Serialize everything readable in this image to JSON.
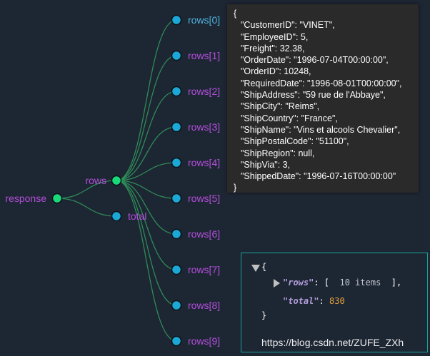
{
  "tree": {
    "root": {
      "label": "response"
    },
    "children": [
      {
        "label": "rows"
      },
      {
        "label": "total"
      }
    ],
    "leaves": [
      "rows[0]",
      "rows[1]",
      "rows[2]",
      "rows[3]",
      "rows[4]",
      "rows[5]",
      "rows[6]",
      "rows[7]",
      "rows[8]",
      "rows[9]"
    ],
    "colors": {
      "link": "#2e8b57",
      "expanded_node": "#19d97a",
      "leaf_node": "#1ba8d6",
      "label_purple": "#b44fdb",
      "label_blue": "#4fb3dc"
    }
  },
  "tooltip": {
    "open": "{",
    "lines": [
      "\"CustomerID\": \"VINET\",",
      "\"EmployeeID\": 5,",
      "\"Freight\": 32.38,",
      "\"OrderDate\": \"1996-07-04T00:00:00\",",
      "\"OrderID\": 10248,",
      "\"RequiredDate\": \"1996-08-01T00:00:00\",",
      "\"ShipAddress\": \"59 rue de l'Abbaye\",",
      "\"ShipCity\": \"Reims\",",
      "\"ShipCountry\": \"France\",",
      "\"ShipName\": \"Vins et alcools Chevalier\",",
      "\"ShipPostalCode\": \"51100\",",
      "\"ShipRegion\": null,",
      "\"ShipVia\": 3,",
      "\"ShippedDate\": \"1996-07-16T00:00:00\""
    ],
    "close": "}"
  },
  "json_view": {
    "open": "{",
    "rows_key": "\"rows\"",
    "rows_sep": ": [",
    "rows_summary": "10 items",
    "rows_close": "],",
    "total_key": "\"total\"",
    "total_sep": ": ",
    "total_value": "830",
    "close": "}"
  },
  "watermark": "https://blog.csdn.net/ZUFE_ZXh"
}
